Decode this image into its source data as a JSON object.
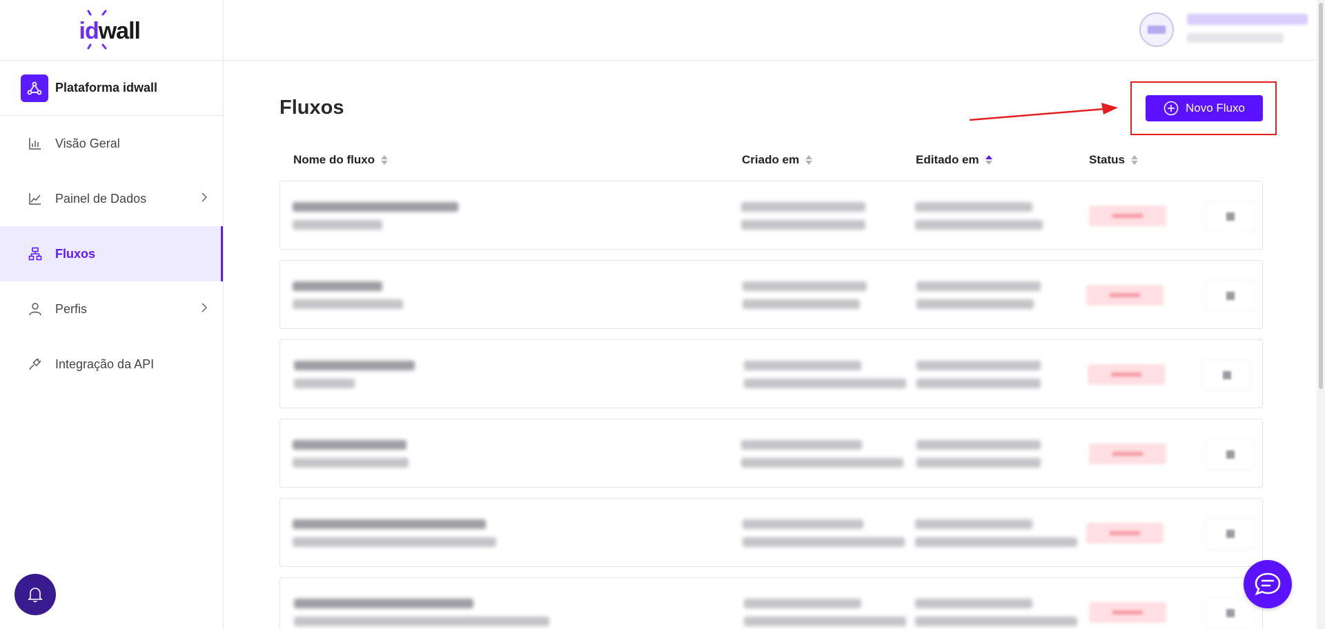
{
  "brand": {
    "logo_id": "id",
    "logo_wall": "wall",
    "platform_label": "Plataforma idwall",
    "accent": "#5b12ff"
  },
  "sidebar": {
    "items": [
      {
        "label": "Visão Geral",
        "icon": "bar-chart-icon",
        "has_chevron": false,
        "active": false
      },
      {
        "label": "Painel de Dados",
        "icon": "line-chart-icon",
        "has_chevron": true,
        "active": false
      },
      {
        "label": "Fluxos",
        "icon": "flow-icon",
        "has_chevron": false,
        "active": true
      },
      {
        "label": "Perfis",
        "icon": "user-icon",
        "has_chevron": true,
        "active": false
      },
      {
        "label": "Integração da API",
        "icon": "plug-icon",
        "has_chevron": false,
        "active": false
      }
    ]
  },
  "main": {
    "title": "Fluxos",
    "new_button_label": "Novo Fluxo",
    "columns": {
      "name": "Nome do fluxo",
      "created": "Criado em",
      "edited": "Editado em",
      "status": "Status"
    }
  }
}
